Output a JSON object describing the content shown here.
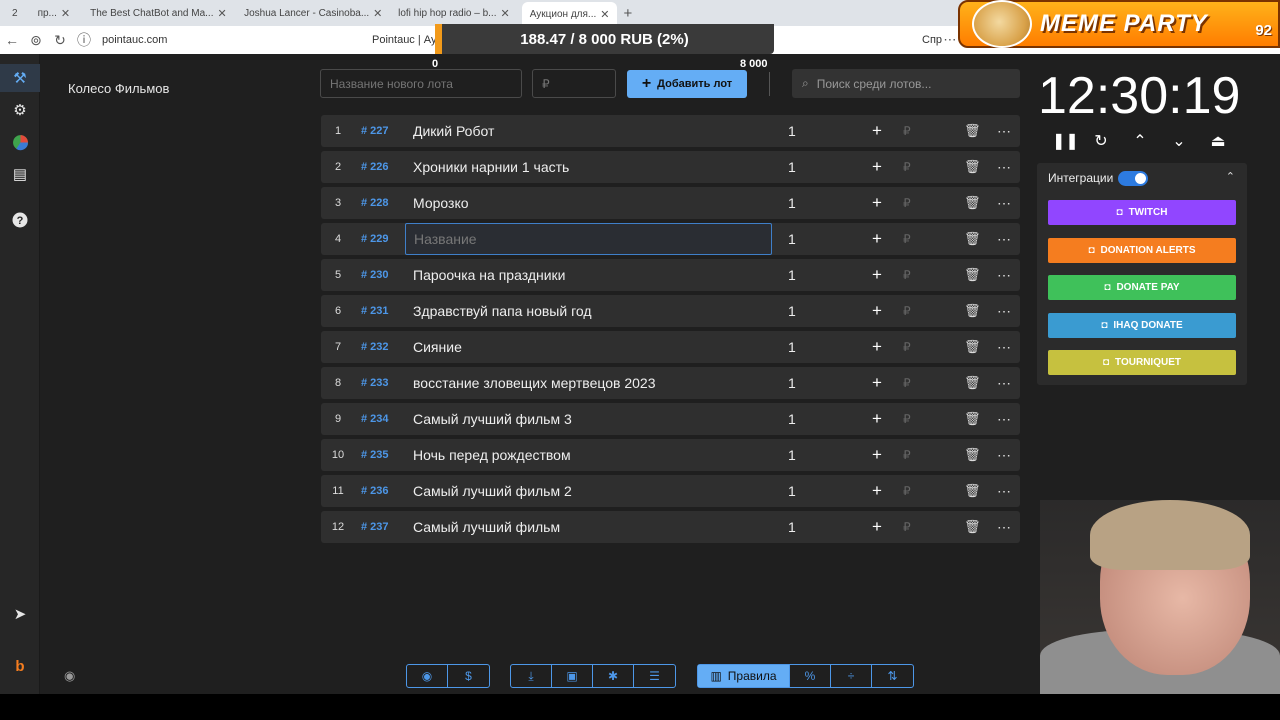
{
  "browser": {
    "tabs": [
      {
        "label": "2",
        "active": false
      },
      {
        "label": "пр...",
        "active": false
      },
      {
        "label": "The Best ChatBot and Ma...",
        "active": false
      },
      {
        "label": "Joshua Lancer - Casinoba...",
        "active": false
      },
      {
        "label": "lofi hip hop radio – b...",
        "active": false
      },
      {
        "label": "Аукцион для...",
        "active": true
      }
    ],
    "url": "pointauc.com",
    "page_title": "Pointauc | Ау",
    "right_link": "Спр"
  },
  "overlay": {
    "progress_text": "188.47 / 8 000 RUB (2%)",
    "progress_fraction": 0.02,
    "scale_min": "0",
    "scale_max": "8 000",
    "banner_title": "MEME PARTY",
    "banner_number": "92"
  },
  "sidebar": {
    "auction_name": "Колесо Фильмов",
    "icons": [
      "auction-icon",
      "gear-icon",
      "wheel-icon",
      "clipboard-icon",
      "help-icon",
      "telegram-icon",
      "brand-icon",
      "eye-icon"
    ]
  },
  "toolbar": {
    "lot_name_placeholder": "Название нового лота",
    "price_placeholder": "₽",
    "add_lot_label": "Добавить лот",
    "search_placeholder": "Поиск среди лотов..."
  },
  "lots": [
    {
      "idx": "1",
      "id": "# 227",
      "name": "Дикий Робот",
      "amount": "1"
    },
    {
      "idx": "2",
      "id": "# 226",
      "name": "Хроники нарнии 1 часть",
      "amount": "1"
    },
    {
      "idx": "3",
      "id": "# 228",
      "name": "Морозко",
      "amount": "1"
    },
    {
      "idx": "4",
      "id": "# 229",
      "name": "",
      "placeholder": "Название",
      "amount": "1"
    },
    {
      "idx": "5",
      "id": "# 230",
      "name": "Пароочка на праздники",
      "amount": "1"
    },
    {
      "idx": "6",
      "id": "# 231",
      "name": "Здравствуй папа новый год",
      "amount": "1"
    },
    {
      "idx": "7",
      "id": "# 232",
      "name": "Сияние",
      "amount": "1"
    },
    {
      "idx": "8",
      "id": "# 233",
      "name": "восстание зловещих мертвецов 2023",
      "amount": "1"
    },
    {
      "idx": "9",
      "id": "# 234",
      "name": "Самый лучший фильм 3",
      "amount": "1"
    },
    {
      "idx": "10",
      "id": "# 235",
      "name": "Ночь перед рождеством",
      "amount": "1"
    },
    {
      "idx": "11",
      "id": "# 236",
      "name": "Самый лучший фильм 2",
      "amount": "1"
    },
    {
      "idx": "12",
      "id": "# 237",
      "name": "Самый лучший фильм",
      "amount": "1"
    }
  ],
  "lot_actions": {
    "plus": "+",
    "currency": "₽",
    "more": "⋯"
  },
  "timer": {
    "time": "12:30:19"
  },
  "integrations": {
    "title": "Интеграции",
    "enabled": true,
    "buttons": [
      {
        "label": "TWITCH",
        "color": "#9146ff"
      },
      {
        "label": "DONATION ALERTS",
        "color": "#f57d1f"
      },
      {
        "label": "DONATE PAY",
        "color": "#3fc15a"
      },
      {
        "label": "IHAQ DONATE",
        "color": "#3a9bd1"
      },
      {
        "label": "TOURNIQUET",
        "color": "#c6c13f"
      }
    ]
  },
  "bottom": {
    "rules_label": "Правила",
    "percent_label": "%"
  },
  "colors": {
    "accent": "#64adf5",
    "link": "#4d97e8",
    "background": "#1f1f1f",
    "row": "#2f2f2f"
  }
}
